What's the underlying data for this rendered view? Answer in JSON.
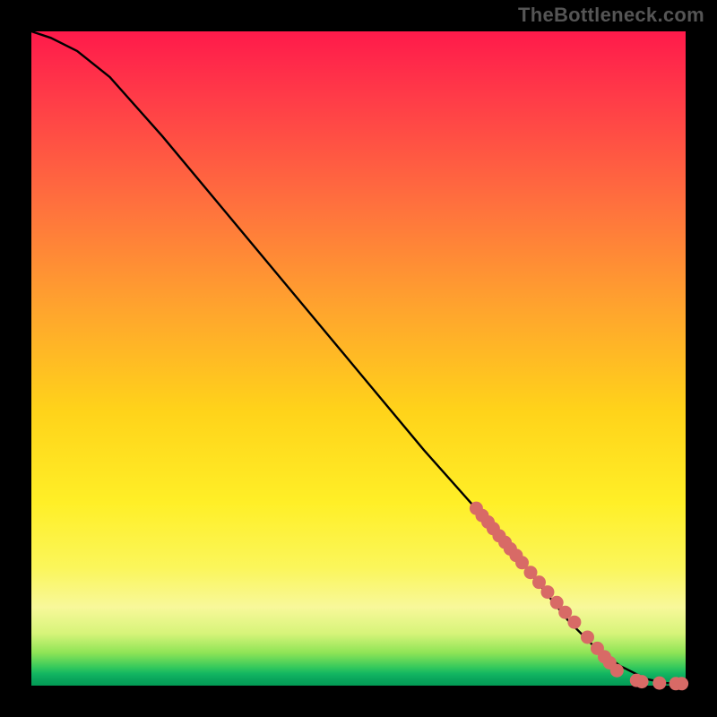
{
  "watermark": "TheBottleneck.com",
  "colors": {
    "marker": "#d86a66",
    "curve": "#000000",
    "frame_bg": "#000000"
  },
  "chart_data": {
    "type": "line",
    "title": "",
    "xlabel": "",
    "ylabel": "",
    "xlim": [
      0,
      100
    ],
    "ylim": [
      0,
      100
    ],
    "grid": false,
    "legend": false,
    "curve": {
      "name": "bottleneck-curve",
      "x": [
        0,
        3,
        7,
        12,
        20,
        30,
        40,
        50,
        60,
        68,
        74,
        78,
        82,
        86,
        90,
        94,
        97,
        100
      ],
      "y": [
        100,
        99,
        97,
        93,
        84,
        72,
        60,
        48,
        36,
        27,
        20,
        15,
        10,
        6,
        3,
        1,
        0.4,
        0.3
      ]
    },
    "series": [
      {
        "name": "highlighted-points",
        "type": "scatter",
        "color": "#d86a66",
        "x": [
          68.0,
          68.9,
          69.8,
          70.6,
          71.5,
          72.4,
          73.2,
          74.1,
          75.0,
          76.3,
          77.6,
          78.9,
          80.3,
          81.6,
          83.0,
          85.0,
          86.5,
          87.6,
          88.4,
          89.5,
          92.5,
          93.3,
          96.0,
          98.5,
          99.4
        ],
        "y": [
          27.1,
          26.0,
          25.0,
          24.0,
          22.9,
          21.9,
          20.9,
          19.9,
          18.8,
          17.3,
          15.8,
          14.3,
          12.7,
          11.2,
          9.7,
          7.4,
          5.7,
          4.4,
          3.5,
          2.3,
          0.8,
          0.6,
          0.4,
          0.3,
          0.3
        ]
      }
    ]
  }
}
